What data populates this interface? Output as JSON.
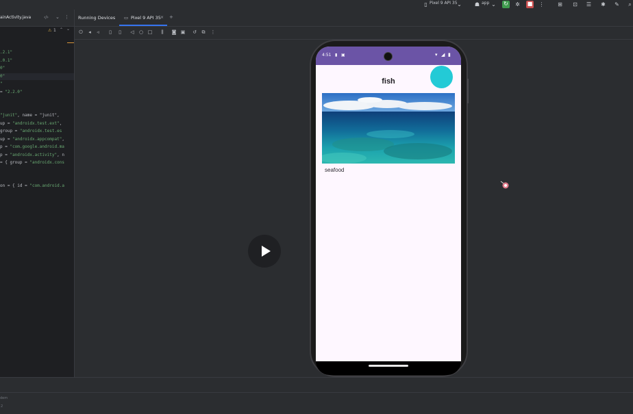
{
  "toolbar": {
    "device_label": "Pixel 9 API 35",
    "run_config_label": "app"
  },
  "editor": {
    "file_tab_label": "ainActivity.java",
    "warning_count": "1",
    "code_lines": [
      {
        "pre": "",
        "str": ".2.1\"",
        "post": ""
      },
      {
        "pre": "",
        "str": ".0.1\"",
        "post": ""
      },
      {
        "pre": "",
        "str": "0\"",
        "post": ""
      },
      {
        "pre": "",
        "str": "0\"",
        "post": ""
      },
      {
        "pre": "",
        "str": "\"",
        "post": ""
      },
      {
        "pre": "= ",
        "str": "\"2.2.0\"",
        "post": ""
      },
      {
        "pre": " ",
        "str": "\"junit\"",
        "post": ", name = \"junit\","
      },
      {
        "pre": "up = ",
        "str": "\"androidx.test.ext\"",
        "post": ","
      },
      {
        "pre": " group = ",
        "str": "\"androidx.test.es",
        "post": ""
      },
      {
        "pre": "up = ",
        "str": "\"androidx.appcompat\"",
        "post": ","
      },
      {
        "pre": "p = ",
        "str": "\"com.google.android.ma",
        "post": ""
      },
      {
        "pre": "p = ",
        "str": "\"androidx.activity\"",
        "post": ", n"
      },
      {
        "pre": "= { group = ",
        "str": "\"androidx.cons",
        "post": ""
      },
      {
        "pre": "on = { id = ",
        "str": "\"com.android.a",
        "post": ""
      }
    ]
  },
  "running_devices": {
    "panel_title": "Running Devices",
    "device_tab_label": "Pixel 9 API 35"
  },
  "phone": {
    "status_time": "4:51",
    "app_title": "fish",
    "caption": "seafood",
    "fab_color": "#23cad6",
    "statusbar_color": "#6b54a6"
  },
  "bottom": {
    "line1": "dem",
    "line2": "2"
  }
}
